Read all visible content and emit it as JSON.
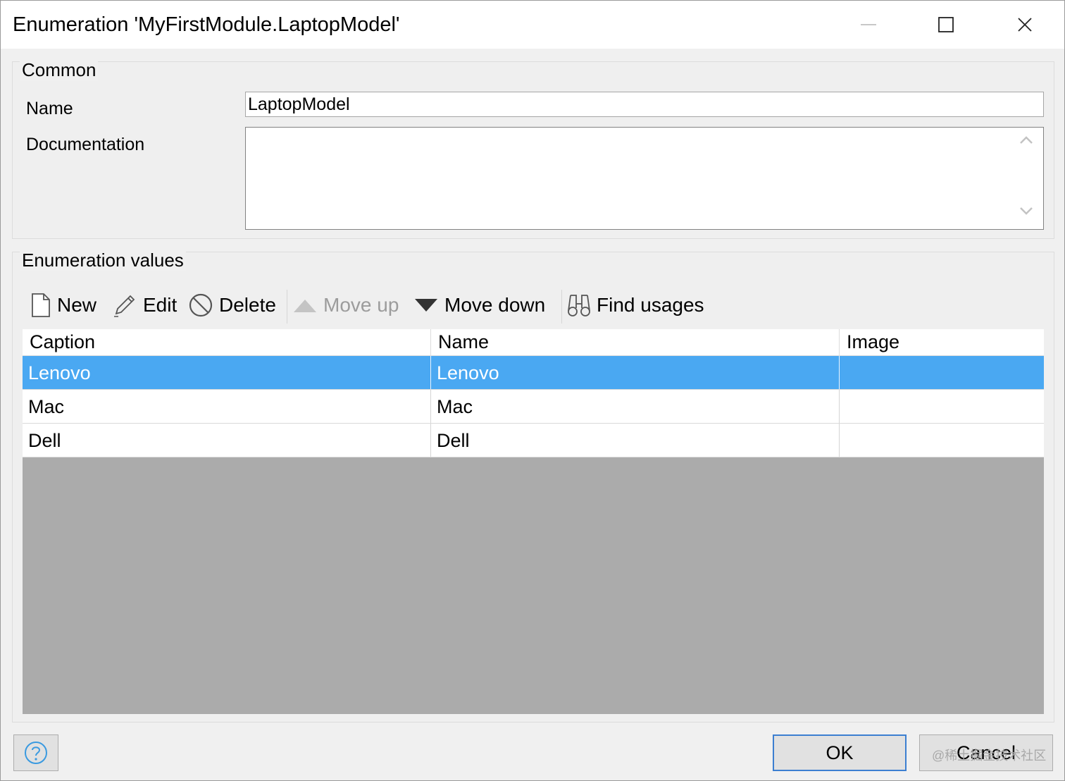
{
  "window": {
    "title": "Enumeration 'MyFirstModule.LaptopModel'",
    "minimize_icon": "minimize-icon",
    "maximize_icon": "maximize-icon",
    "close_icon": "close-icon"
  },
  "common": {
    "group_label": "Common",
    "name_label": "Name",
    "name_value": "LaptopModel",
    "documentation_label": "Documentation",
    "documentation_value": ""
  },
  "enumeration": {
    "group_label": "Enumeration values",
    "toolbar": [
      {
        "label": "New",
        "icon": "new-document-icon",
        "enabled": true
      },
      {
        "label": "Edit",
        "icon": "pencil-icon",
        "enabled": true
      },
      {
        "label": "Delete",
        "icon": "delete-icon",
        "enabled": true
      },
      {
        "label": "Move up",
        "icon": "triangle-up-icon",
        "enabled": false
      },
      {
        "label": "Move down",
        "icon": "triangle-down-icon",
        "enabled": true
      },
      {
        "label": "Find usages",
        "icon": "binoculars-icon",
        "enabled": true
      }
    ],
    "columns": [
      "Caption",
      "Name",
      "Image"
    ],
    "rows": [
      {
        "caption": "Lenovo",
        "name": "Lenovo",
        "image": "",
        "selected": true
      },
      {
        "caption": "Mac",
        "name": "Mac",
        "image": "",
        "selected": false
      },
      {
        "caption": "Dell",
        "name": "Dell",
        "image": "",
        "selected": false
      }
    ]
  },
  "footer": {
    "help_icon": "help-icon",
    "ok_label": "OK",
    "cancel_label": "Cancel",
    "watermark": "@稀土掘金技术社区"
  },
  "colors": {
    "selection": "#4aa8f2",
    "ok_border": "#3c7fd1",
    "grid_empty": "#ababab"
  }
}
